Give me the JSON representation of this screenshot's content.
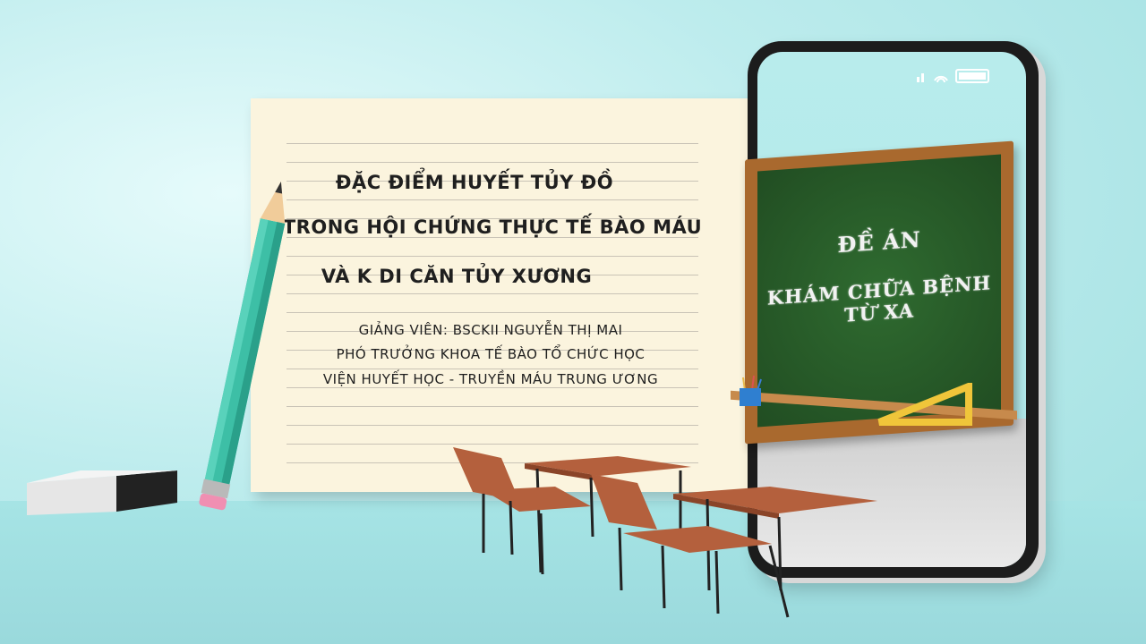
{
  "paper": {
    "title_line1": "ĐẶC ĐIỂM HUYẾT TỦY ĐỒ",
    "title_line2": "TRONG HỘI CHỨNG THỰC TẾ BÀO MÁU",
    "title_line3": "VÀ K DI CĂN TỦY XƯƠNG",
    "lecturer": "GIẢNG VIÊN: BSCKII NGUYỄN THỊ MAI",
    "position": "PHÓ TRƯỞNG KHOA TẾ BÀO TỔ CHỨC HỌC",
    "institute": "VIỆN HUYẾT HỌC - TRUYỀN MÁU TRUNG ƯƠNG"
  },
  "board": {
    "line1": "ĐỀ ÁN",
    "line2": "KHÁM CHỮA BỆNH TỪ XA"
  },
  "colors": {
    "background": "#bdeced",
    "paper": "#fbf4de",
    "chalkboard": "#2b5e2c",
    "board_frame": "#a9692e",
    "pencil": "#3dbfa6",
    "desk": "#b4603d"
  }
}
